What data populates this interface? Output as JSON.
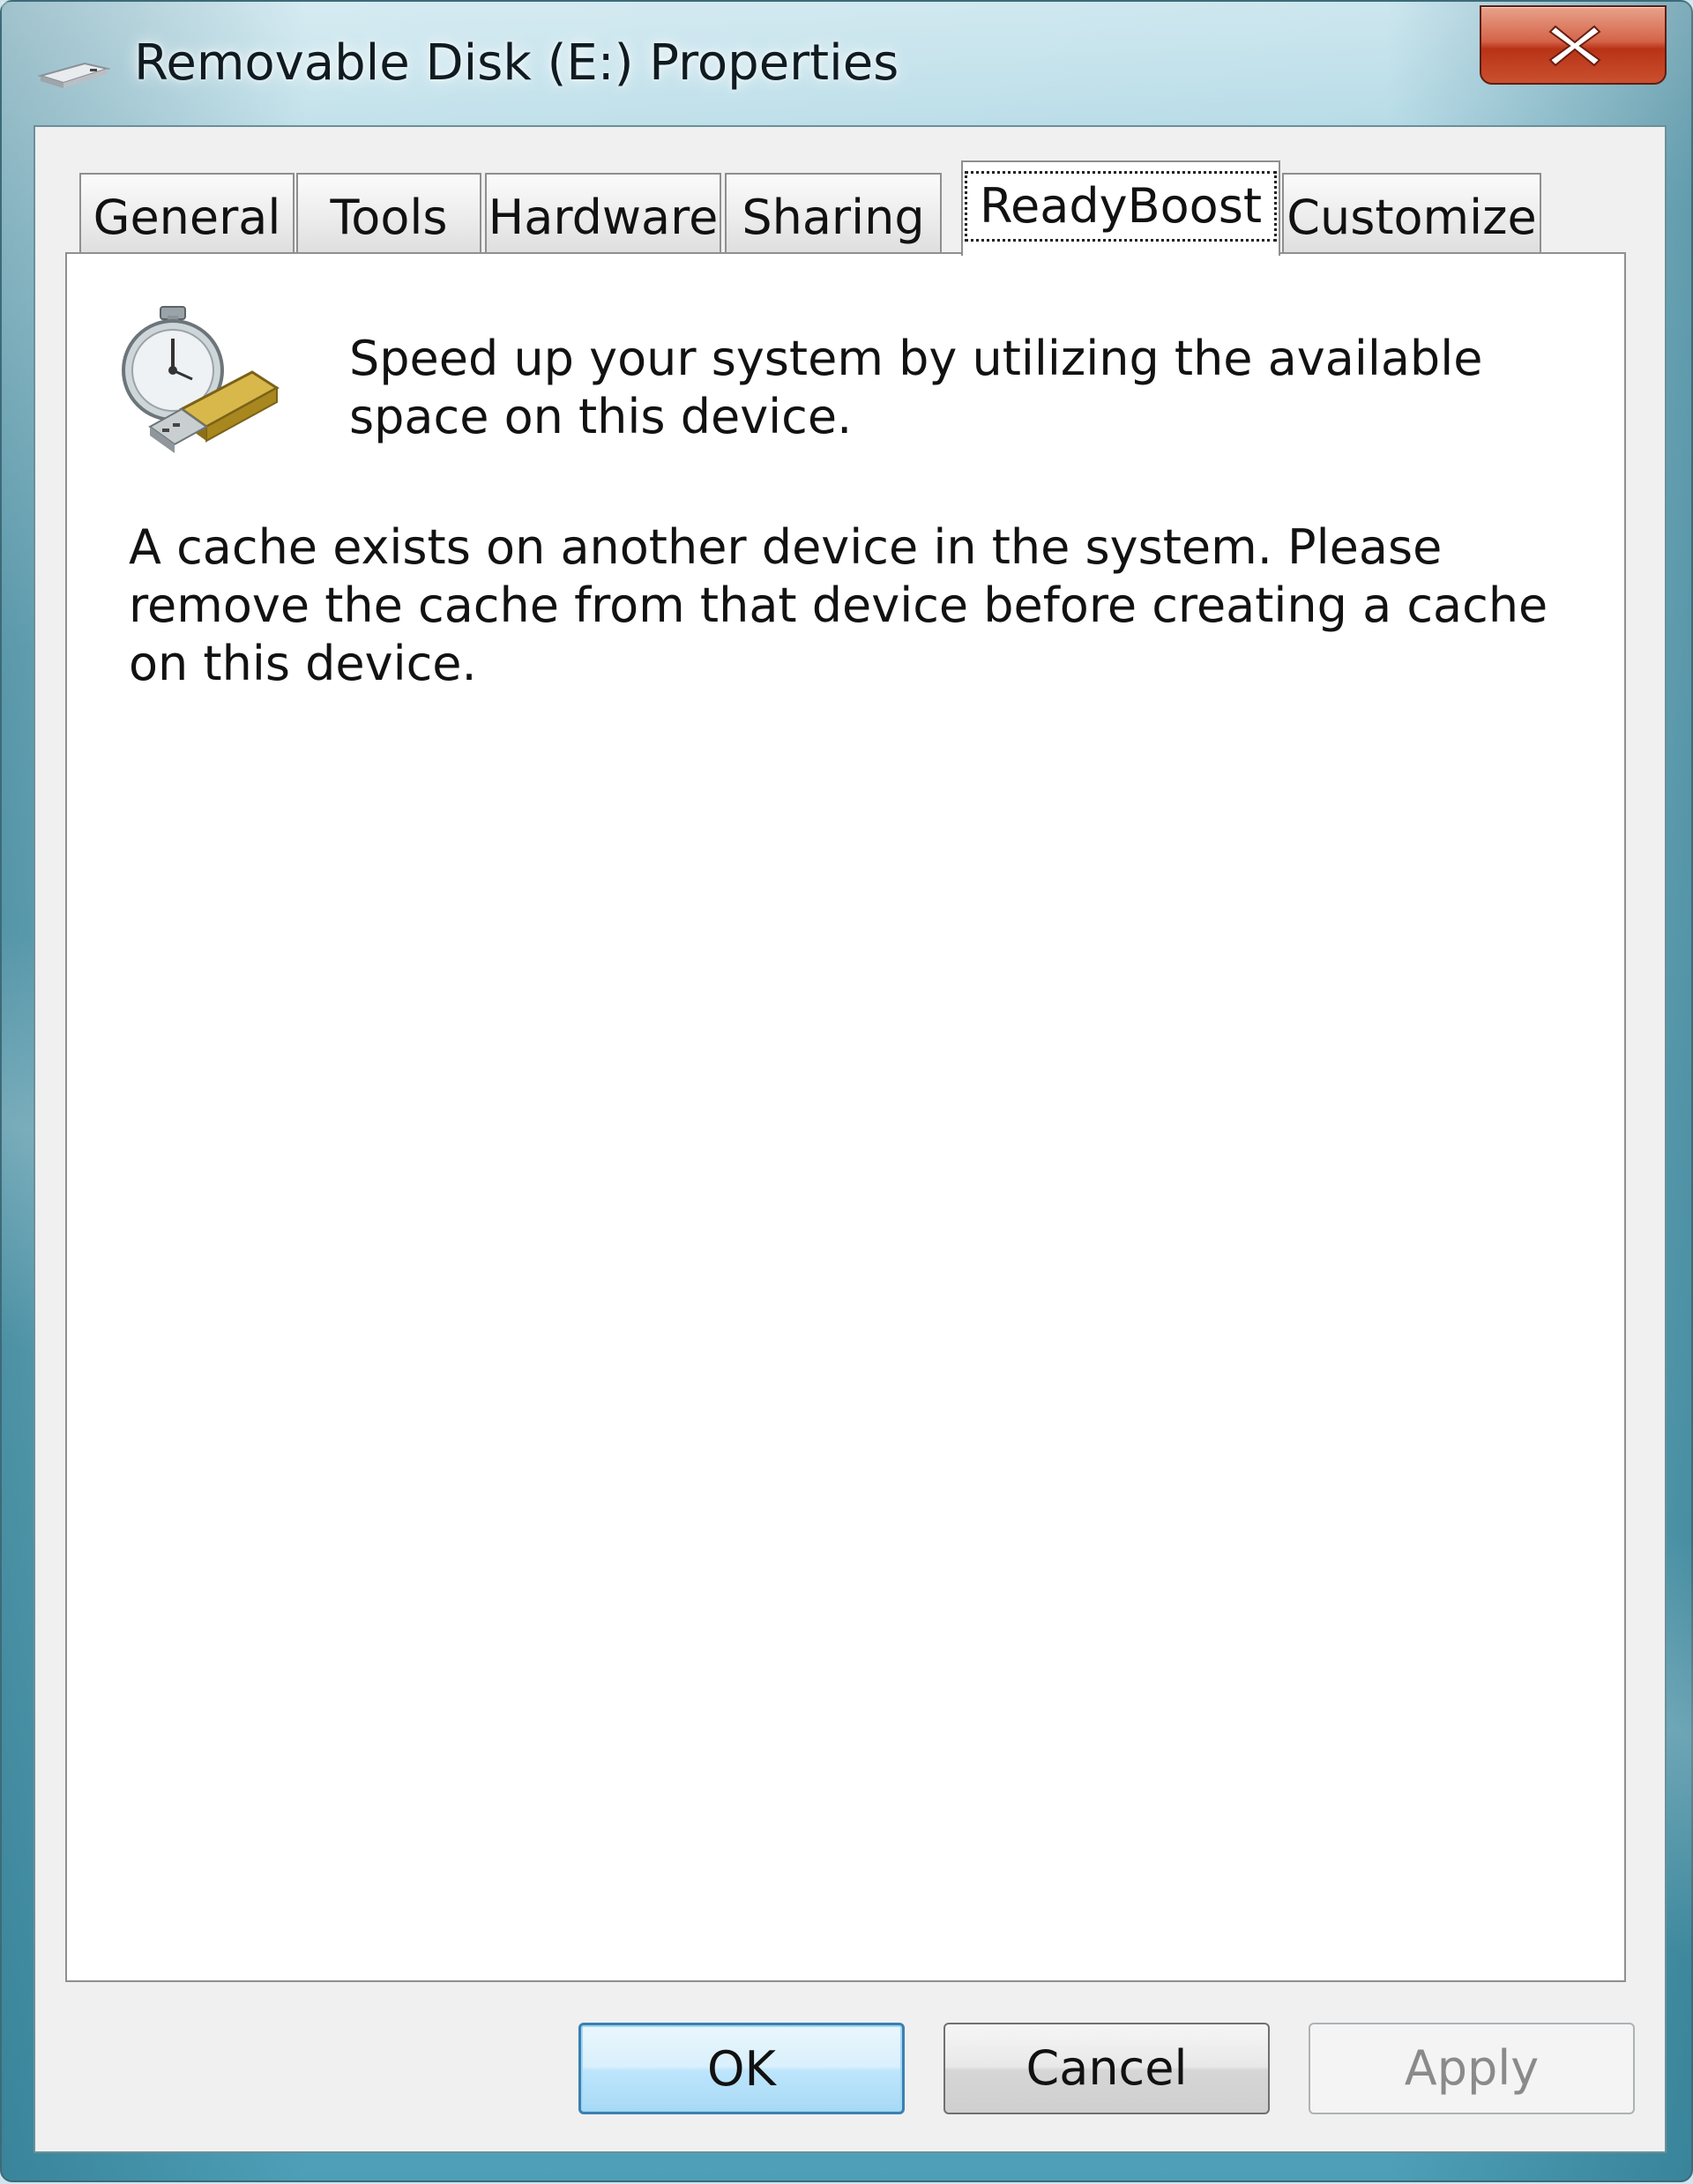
{
  "window": {
    "title": "Removable Disk (E:) Properties",
    "title_icon": "removable-drive-icon",
    "close_icon": "close-icon",
    "accent_close": "#c9502f"
  },
  "tabs": [
    {
      "label": "General",
      "active": false
    },
    {
      "label": "Tools",
      "active": false
    },
    {
      "label": "Hardware",
      "active": false
    },
    {
      "label": "Sharing",
      "active": false
    },
    {
      "label": "ReadyBoost",
      "active": true
    },
    {
      "label": "Customize",
      "active": false
    }
  ],
  "readyboost": {
    "icon": "readyboost-stopwatch-usb-icon",
    "headline": "Speed up your system by utilizing the available space on this device.",
    "message": "A cache exists on another device in the system.  Please remove the cache from that device before creating a cache on this device."
  },
  "buttons": {
    "ok": "OK",
    "cancel": "Cancel",
    "apply": "Apply",
    "apply_enabled": false
  }
}
